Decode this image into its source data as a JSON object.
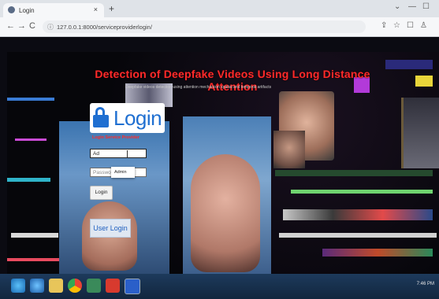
{
  "browser": {
    "tab_title": "Login",
    "tab_close": "×",
    "new_tab": "+",
    "url": "127.0.0.1:8000/serviceproviderlogin/",
    "window_controls": [
      "⌄",
      "—",
      "☐"
    ],
    "nav": {
      "back": "←",
      "forward": "→",
      "reload": "C"
    },
    "toolbar_icons": [
      "⇪",
      "☆",
      "☐",
      "♙"
    ]
  },
  "page": {
    "title": "Detection of Deepfake Videos Using Long Distance Attention",
    "subtitle": "Deepfake videos detection using attention mechanism spatial and temporal artifacts",
    "login": {
      "logo_word": "Login",
      "subtitle": "Login Service Provider",
      "username_value": "Ad",
      "password_placeholder": "Password",
      "autocomplete_option": "Admin",
      "login_button": "Login",
      "user_login_button": "User Login"
    }
  },
  "taskbar": {
    "icons": [
      "edge-icon",
      "ie-icon",
      "explorer-icon",
      "chrome-icon",
      "app-icon",
      "pdf-icon",
      "app2-icon"
    ],
    "clock": "7:46 PM"
  },
  "colors": {
    "title_red": "#ff2a2a",
    "login_blue": "#1f6fd1",
    "taskbar": "#1d3a5c"
  }
}
